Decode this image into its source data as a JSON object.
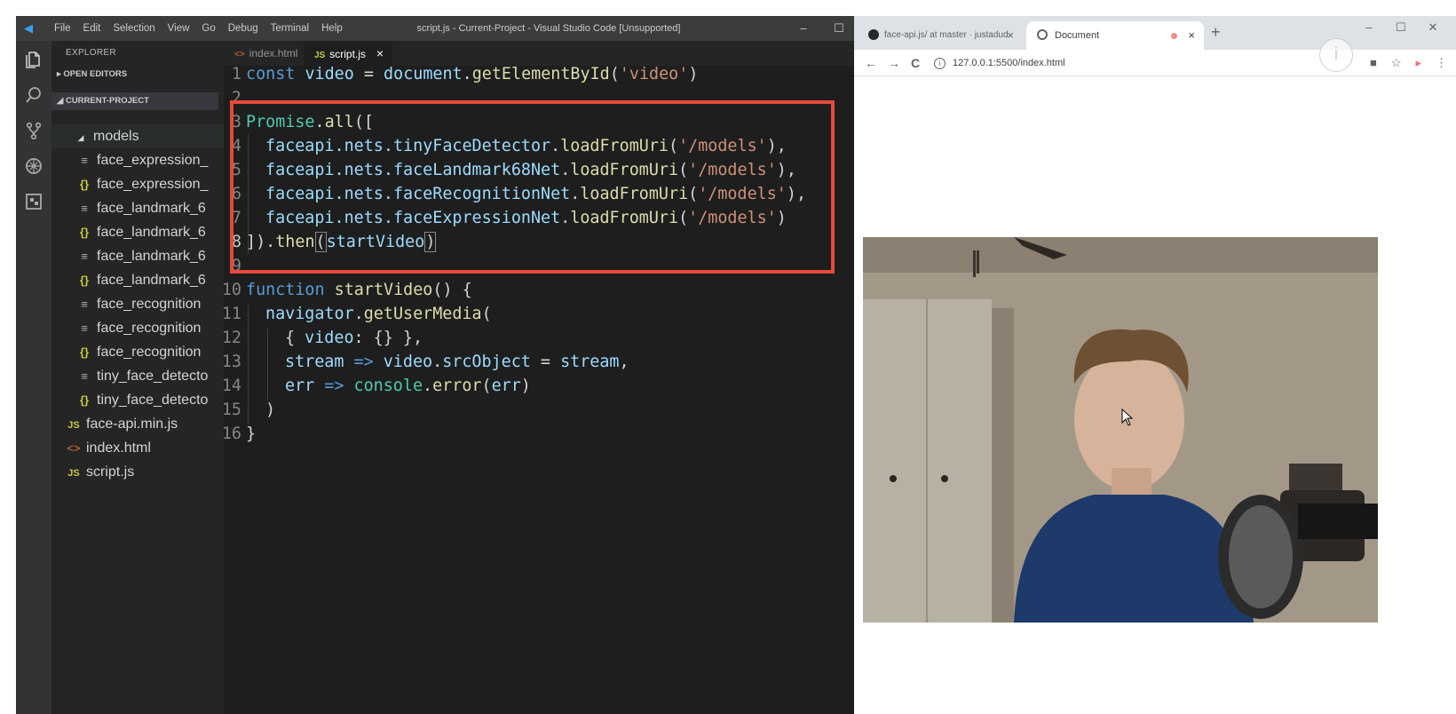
{
  "vscode": {
    "menu": [
      "File",
      "Edit",
      "Selection",
      "View",
      "Go",
      "Debug",
      "Terminal",
      "Help"
    ],
    "window_title": "script.js - Current-Project - Visual Studio Code [Unsupported]",
    "window_controls": [
      "–",
      "☐",
      "✕"
    ],
    "activity_icons": [
      "files-icon",
      "search-icon",
      "source-control-icon",
      "debug-icon",
      "extensions-icon"
    ],
    "explorer": {
      "title": "EXPLORER",
      "open_editors": "OPEN EDITORS",
      "project": "CURRENT-PROJECT",
      "items": [
        {
          "label": "models",
          "icon": "folder-open-icon"
        },
        {
          "label": "face_expression_",
          "icon": "file-icon"
        },
        {
          "label": "face_expression_",
          "icon": "json-icon"
        },
        {
          "label": "face_landmark_6",
          "icon": "file-icon"
        },
        {
          "label": "face_landmark_6",
          "icon": "json-icon"
        },
        {
          "label": "face_landmark_6",
          "icon": "file-icon"
        },
        {
          "label": "face_landmark_6",
          "icon": "json-icon"
        },
        {
          "label": "face_recognition",
          "icon": "file-icon"
        },
        {
          "label": "face_recognition",
          "icon": "file-icon"
        },
        {
          "label": "face_recognition",
          "icon": "json-icon"
        },
        {
          "label": "tiny_face_detecto",
          "icon": "file-icon"
        },
        {
          "label": "tiny_face_detecto",
          "icon": "json-icon"
        },
        {
          "label": "face-api.min.js",
          "icon": "js-icon"
        },
        {
          "label": "index.html",
          "icon": "html-icon"
        },
        {
          "label": "script.js",
          "icon": "js-icon"
        }
      ]
    },
    "tabs": [
      {
        "label": "index.html",
        "icon": "<>"
      },
      {
        "label": "script.js",
        "icon": "JS",
        "close": "×"
      }
    ],
    "editor_actions": "◫  ···",
    "line_numbers": [
      "1",
      "2",
      "3",
      "4",
      "5",
      "6",
      "7",
      "8",
      "9",
      "10",
      "11",
      "12",
      "13",
      "14",
      "15",
      "16"
    ],
    "code": {
      "l1": {
        "kw": "const",
        "var": "video",
        "eq": " = ",
        "obj": "document",
        "dot": ".",
        "fn": "getElementById",
        "open": "(",
        "str": "'video'",
        "close": ")"
      },
      "l3": {
        "cls": "Promise",
        "dot": ".",
        "fn": "all",
        "rest": "(["
      },
      "l4": {
        "obj": "faceapi",
        "path": ".nets.",
        "prop": "tinyFaceDetector",
        "dot": ".",
        "fn": "loadFromUri",
        "open": "(",
        "str": "'/models'",
        "close": "),"
      },
      "l5": {
        "obj": "faceapi",
        "path": ".nets.",
        "prop": "faceLandmark68Net",
        "dot": ".",
        "fn": "loadFromUri",
        "open": "(",
        "str": "'/models'",
        "close": "),"
      },
      "l6": {
        "obj": "faceapi",
        "path": ".nets.",
        "prop": "faceRecognitionNet",
        "dot": ".",
        "fn": "loadFromUri",
        "open": "(",
        "str": "'/models'",
        "close": "),"
      },
      "l7": {
        "obj": "faceapi",
        "path": ".nets.",
        "prop": "faceExpressionNet",
        "dot": ".",
        "fn": "loadFromUri",
        "open": "(",
        "str": "'/models'",
        "close": ")"
      },
      "l8": {
        "start": "])",
        "dot": ".",
        "fn": "then",
        "open": "(",
        "arg": "startVideo",
        "close": ")"
      },
      "l10": {
        "kw": "function",
        "fn": "startVideo",
        "rest": "() {"
      },
      "l11": {
        "obj": "navigator",
        "dot": ".",
        "fn": "getUserMedia",
        "rest": "("
      },
      "l12": {
        "open": "{ ",
        "prop": "video",
        "rest": ": {} },"
      },
      "l13": {
        "a": "stream",
        "arrow": " => ",
        "b": "video",
        "dot": ".",
        "c": "srcObject",
        "eq": " = ",
        "d": "stream",
        "end": ","
      },
      "l14": {
        "a": "err",
        "arrow": " => ",
        "b": "console",
        "dot": ".",
        "fn": "error",
        "open": "(",
        "c": "err",
        "close": ")"
      },
      "l15": {
        "text": ")"
      },
      "l16": {
        "text": "}"
      }
    },
    "highlight_color": "#e8493b"
  },
  "browser": {
    "tabs": [
      {
        "label": "face-api.js/ at master · justadudew",
        "icon": "github-icon",
        "close": "×"
      },
      {
        "label": "Document",
        "icon": "globe-icon",
        "close": "×"
      }
    ],
    "new_tab": "+",
    "window_controls": [
      "–",
      "☐",
      "✕"
    ],
    "url": "127.0.0.1:5500/index.html",
    "nav": {
      "back": "←",
      "forward": "→",
      "reload": "C"
    },
    "overlay_icon": "i"
  }
}
